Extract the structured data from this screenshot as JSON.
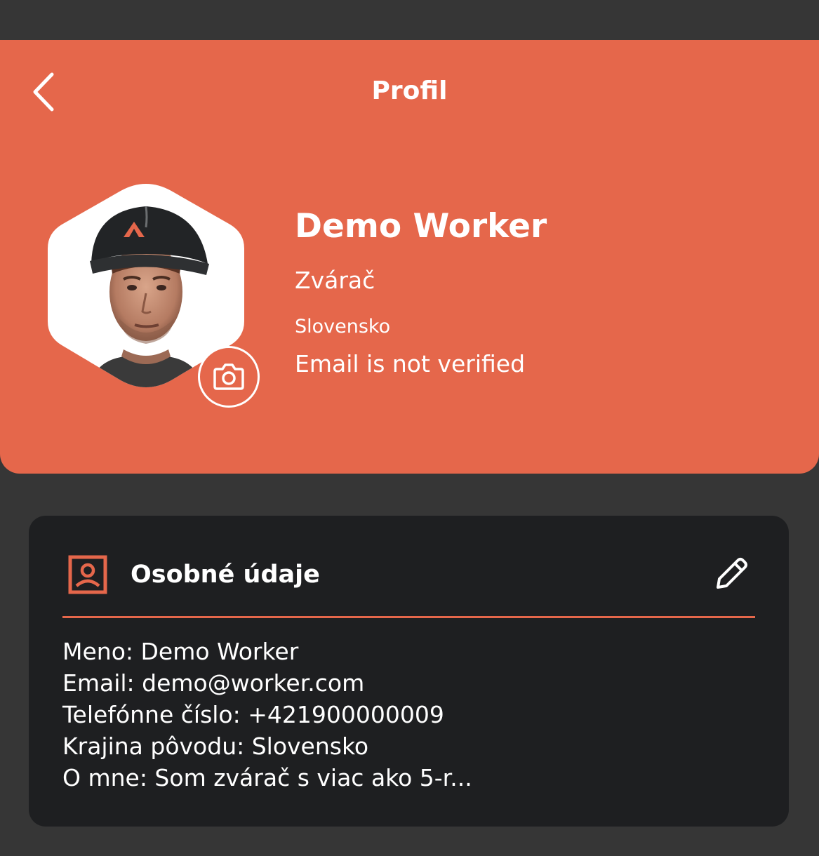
{
  "header": {
    "title": "Profil",
    "back_icon": "chevron-left-icon",
    "accent_color": "#e5674b"
  },
  "profile": {
    "name": "Demo Worker",
    "role": "Zvárač",
    "country": "Slovensko",
    "email_status": "Email is not verified",
    "camera_icon": "camera-icon"
  },
  "personal_info": {
    "title": "Osobné údaje",
    "icon": "contact-card-icon",
    "edit_icon": "pencil-icon",
    "lines": [
      "Meno: Demo Worker",
      "Email: demo@worker.com",
      "Telefónne číslo: +421900000009",
      "Krajina pôvodu: Slovensko",
      "O mne: Som zvárač s viac ako 5-r..."
    ]
  }
}
